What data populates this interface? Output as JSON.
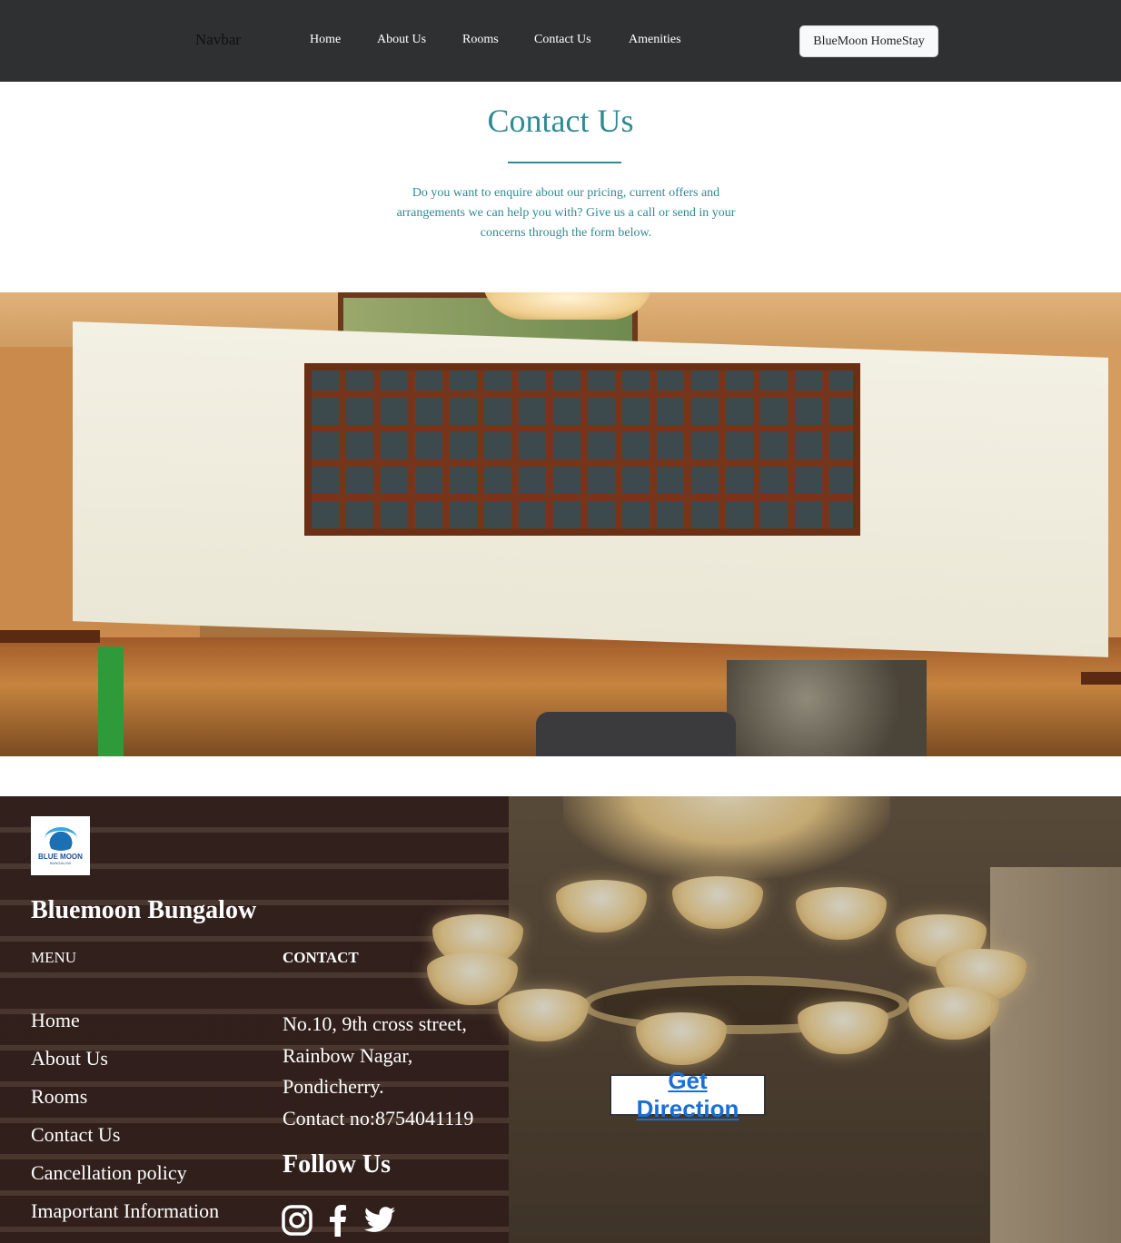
{
  "navbar": {
    "brand": "Navbar",
    "links": [
      "Home",
      "About Us",
      "Rooms",
      "Contact Us",
      "Amenities"
    ],
    "button_label": "BlueMoon HomeStay"
  },
  "header": {
    "title": "Contact Us",
    "intro": "Do you want to enquire about our pricing, current offers and arrangements we can help you with? Give us a call or send in your concerns through the form below."
  },
  "footer": {
    "logo_text": "BLUE MOON",
    "logo_subtext": "BUNGALOW",
    "brand": "Bluemoon Bungalow",
    "menu_heading": "MENU",
    "contact_heading": "CONTACT",
    "menu_items": [
      "Home",
      "About Us",
      "Rooms",
      "Contact Us",
      "Cancellation policy",
      "Imaportant Information"
    ],
    "address_lines": [
      "No.10, 9th cross street,",
      "Rainbow Nagar,",
      "Pondicherry.",
      "Contact no:8754041119"
    ],
    "follow_heading": "Follow Us",
    "social_icons": [
      "instagram-icon",
      "facebook-icon",
      "twitter-icon"
    ],
    "direction_button": "Get Direction"
  },
  "colors": {
    "navbar_bg": "#2f3032",
    "accent": "#2e8b93",
    "link_blue": "#1a6ed8"
  }
}
